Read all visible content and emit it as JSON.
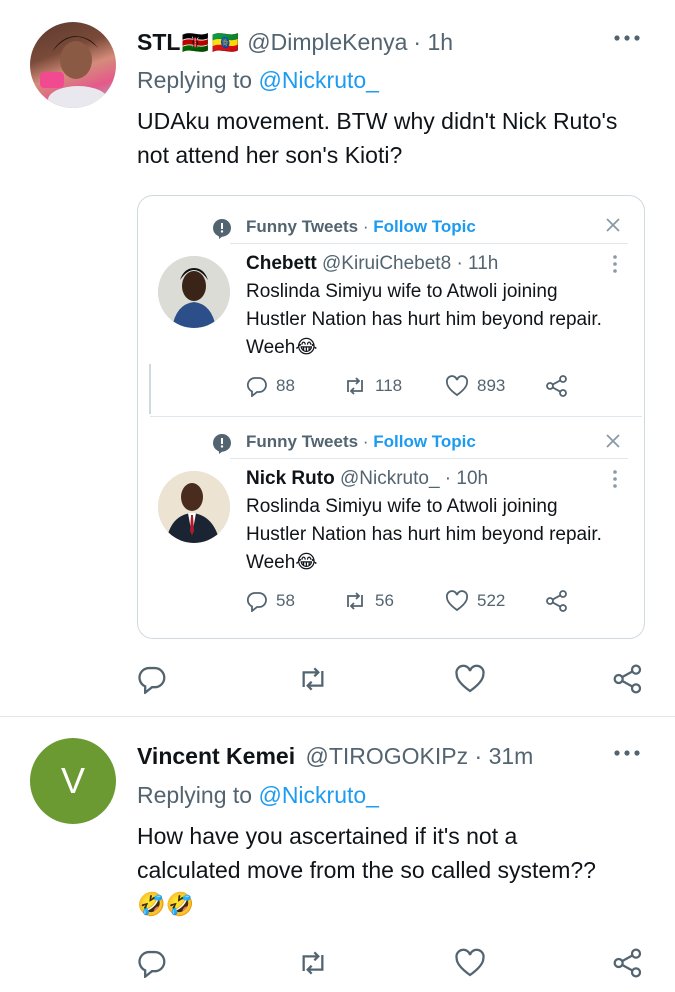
{
  "tweet1": {
    "name": "STL",
    "flags": [
      "🇰🇪",
      "🇪🇹"
    ],
    "handle": "@DimpleKenya",
    "time": "· 1h",
    "replying_prefix": "Replying to",
    "replying_to": "@Nickruto_",
    "text": "UDAku movement. BTW why didn't Nick Ruto's not attend her son's Kioti?",
    "quoted": [
      {
        "topic": "Funny Tweets",
        "dot": "·",
        "follow": "Follow Topic",
        "name": "Chebett",
        "handle": "@KiruiChebet8",
        "time": "· 11h",
        "text": "Roslinda Simiyu wife to Atwoli joining Hustler Nation has hurt him beyond repair. Weeh😂",
        "replies": "88",
        "retweets": "118",
        "likes": "893"
      },
      {
        "topic": "Funny Tweets",
        "dot": "·",
        "follow": "Follow Topic",
        "name": "Nick Ruto",
        "handle": "@Nickruto_",
        "time": "· 10h",
        "text": "Roslinda Simiyu wife to Atwoli joining Hustler Nation has hurt him beyond repair. Weeh😂",
        "replies": "58",
        "retweets": "56",
        "likes": "522"
      }
    ]
  },
  "tweet2": {
    "avatar_letter": "V",
    "name": "Vincent Kemei",
    "handle": "@TIROGOKIPz",
    "time": "· 31m",
    "replying_prefix": "Replying to",
    "replying_to": "@Nickruto_",
    "text": "How have you ascertained if it's not a calculated move from the so called system?? 🤣🤣"
  },
  "icons": {
    "more": "more-dots-icon",
    "reply": "reply-icon",
    "retweet": "retweet-icon",
    "like": "like-icon",
    "share": "share-icon",
    "topic": "topic-icon",
    "close": "close-icon"
  },
  "colors": {
    "link": "#1d9bf0",
    "secondary": "#536471",
    "border": "#cfd9de",
    "avatar_v": "#6a9a31"
  }
}
